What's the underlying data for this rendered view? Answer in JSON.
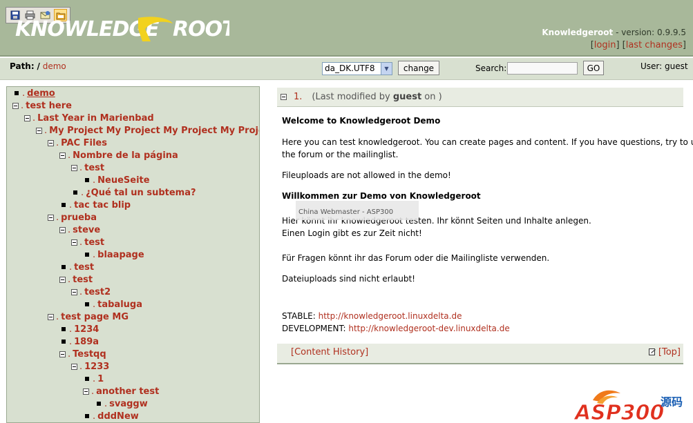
{
  "toolbar": {
    "icons": [
      "save-icon",
      "print-icon",
      "email-icon",
      "folder-icon"
    ]
  },
  "header": {
    "logo_text": "KNOWLEDGE ROOT",
    "app_name": "Knowledgeroot",
    "version_text": " - version: 0.9.9.5",
    "login_label": "login",
    "last_changes_label": "last changes"
  },
  "pathbar": {
    "path_label": "Path:",
    "path_sep": "/",
    "path_item": "demo",
    "locale_value": "da_DK.UTF8",
    "change_label": "change",
    "search_label": "Search:",
    "search_value": "",
    "go_label": "GO",
    "user_label": "User: guest"
  },
  "tree": [
    {
      "label": "demo",
      "marker": "leaf",
      "underline": true
    },
    {
      "label": "test here",
      "marker": "box"
    },
    {
      "label": "Last Year in Marienbad",
      "marker": "box"
    },
    {
      "label": "My Project My Project My Project My Project",
      "marker": "box"
    },
    {
      "label": "PAC Files",
      "marker": "box"
    },
    {
      "label": "Nombre de la página",
      "marker": "box"
    },
    {
      "label": "test",
      "marker": "box"
    },
    {
      "label": "NeueSeite",
      "marker": "leaf"
    },
    {
      "label": "¿Qué tal un subtema?",
      "marker": "leaf"
    },
    {
      "label": "tac tac blip",
      "marker": "leaf"
    },
    {
      "label": "prueba",
      "marker": "box"
    },
    {
      "label": "steve",
      "marker": "box"
    },
    {
      "label": "test",
      "marker": "box"
    },
    {
      "label": "blaapage",
      "marker": "leaf"
    },
    {
      "label": "test",
      "marker": "leaf"
    },
    {
      "label": "test",
      "marker": "box"
    },
    {
      "label": "test2",
      "marker": "box"
    },
    {
      "label": "tabaluga",
      "marker": "leaf"
    },
    {
      "label": "test page MG",
      "marker": "box"
    },
    {
      "label": "1234",
      "marker": "leaf"
    },
    {
      "label": "189a",
      "marker": "leaf"
    },
    {
      "label": "Testqq",
      "marker": "box"
    },
    {
      "label": "1233",
      "marker": "box"
    },
    {
      "label": "1",
      "marker": "leaf"
    },
    {
      "label": "another test",
      "marker": "box"
    },
    {
      "label": "svaggw",
      "marker": "leaf"
    },
    {
      "label": "dddNew",
      "marker": "leaf"
    }
  ],
  "content": {
    "number": "1.",
    "meta_prefix": "(Last modified by ",
    "meta_user": "guest",
    "meta_suffix": " on )",
    "welcome_title": "Welcome to Knowledgeroot Demo",
    "welcome_line1": "Here you can test knowledgeroot. You can create pages and content. If you have questions, try to use",
    "welcome_line2": "the forum or the mailinglist.",
    "fileuploads_en": "Fileuploads are not allowed in the demo!",
    "willkommen_title": "Willkommen zur Demo von Knowledgeroot",
    "de_line1": "Hier könnt ihr knowledgeroot testen. Ihr könnt Seiten und Inhalte anlegen.",
    "de_line2": "Einen Login gibt es zur Zeit nicht!",
    "de_line3": "Für Fragen könnt ihr das Forum oder die Mailingliste verwenden.",
    "de_line4": "Dateiuploads sind nicht erlaubt!",
    "ghost_text": "China Webmaster - ASP300",
    "stable_label": "STABLE:",
    "stable_url": "http://knowledgeroot.linuxdelta.de",
    "dev_label": "DEVELOPMENT:",
    "dev_url": "http://knowledgeroot-dev.linuxdelta.de",
    "history_label": "[Content History]",
    "top_label": "[Top]"
  },
  "watermark": {
    "text": "ASP300",
    "cn_text": "源码"
  }
}
